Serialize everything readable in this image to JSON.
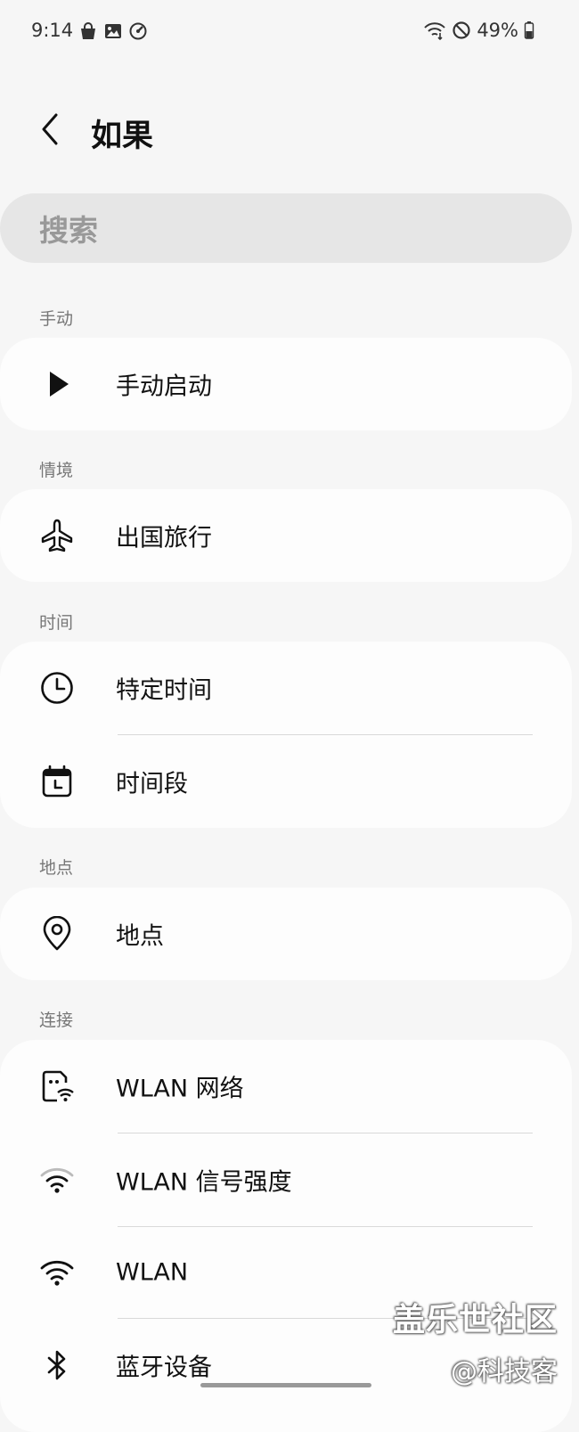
{
  "status_bar": {
    "time": "9:14",
    "battery": "49%",
    "left_icons": [
      "shopping-bag-icon",
      "gallery-icon",
      "speed-icon"
    ],
    "right_icons": [
      "wifi-call-icon",
      "do-not-disturb-icon",
      "battery-icon"
    ]
  },
  "header": {
    "title": "如果",
    "back_icon": "chevron-left-icon"
  },
  "search": {
    "placeholder": "搜索"
  },
  "sections": {
    "manual": {
      "label": "手动",
      "items": [
        {
          "label": "手动启动",
          "icon": "play-icon"
        }
      ]
    },
    "context": {
      "label": "情境",
      "items": [
        {
          "label": "出国旅行",
          "icon": "airplane-icon"
        }
      ]
    },
    "time": {
      "label": "时间",
      "items": [
        {
          "label": "特定时间",
          "icon": "clock-icon"
        },
        {
          "label": "时间段",
          "icon": "calendar-clock-icon"
        }
      ]
    },
    "location": {
      "label": "地点",
      "items": [
        {
          "label": "地点",
          "icon": "location-pin-icon"
        }
      ]
    },
    "connection": {
      "label": "连接",
      "items": [
        {
          "label": "WLAN 网络",
          "icon": "wlan-network-icon"
        },
        {
          "label": "WLAN 信号强度",
          "icon": "wifi-signal-icon"
        },
        {
          "label": "WLAN",
          "icon": "wifi-icon"
        },
        {
          "label": "蓝牙设备",
          "icon": "bluetooth-icon"
        }
      ]
    }
  },
  "watermark": {
    "main": "盖乐世社区",
    "sub": "@科技客"
  },
  "colors": {
    "background": "#f6f6f6",
    "card": "#fdfdfd",
    "search_bg": "#e6e6e6",
    "text": "#111111",
    "section_label": "#777777"
  }
}
